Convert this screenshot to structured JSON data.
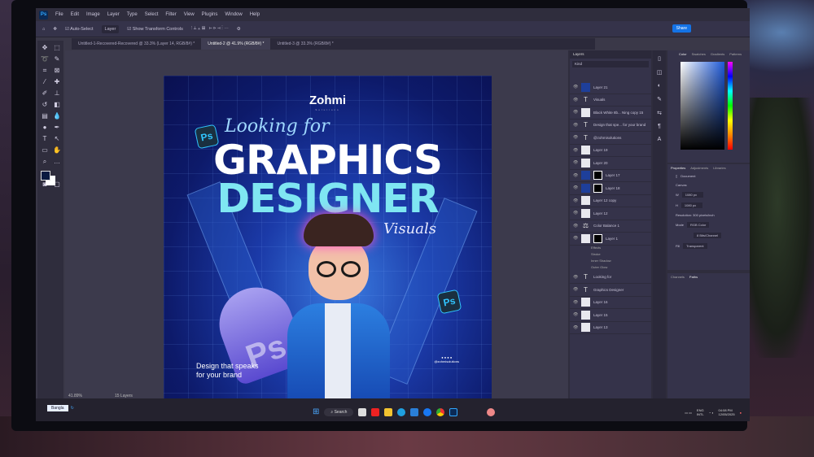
{
  "app": {
    "logo": "Ps",
    "menu": [
      "File",
      "Edit",
      "Image",
      "Layer",
      "Type",
      "Select",
      "Filter",
      "View",
      "Plugins",
      "Window",
      "Help"
    ]
  },
  "options": {
    "auto_select": "Auto-Select",
    "layer_select": "Layer",
    "transform": "Show Transform Controls",
    "share": "Share"
  },
  "tabs": [
    {
      "label": "Untitled-1-Recovered-Recovered @ 33.3% (Layer 14, RGB/8#) *",
      "active": false
    },
    {
      "label": "Untitled-2 @ 41.9% (RGB/8#) *",
      "active": true
    },
    {
      "label": "Untitled-3 @ 33.3% (RGB/8#) *",
      "active": false
    }
  ],
  "poster": {
    "brand": "Zohmi",
    "brand_sub": "Solutions",
    "looking": "Looking for",
    "title1": "GRAPHICS",
    "title2": "DESIGNER",
    "script": "Visuals",
    "badge": "Ps",
    "cap_text": "Ps",
    "tagline1": "Design that speaks",
    "tagline2": "for your brand",
    "handle": "@zohmisolutions"
  },
  "layers": {
    "title": "Layers",
    "search": "Kind",
    "items": [
      {
        "name": "Layer 21",
        "type": "img"
      },
      {
        "name": "Visuals",
        "type": "text"
      },
      {
        "name": "Black White 8b... Ning copy 15",
        "type": "plain"
      },
      {
        "name": "Design that spe... for your brand",
        "type": "text"
      },
      {
        "name": "@zohmisolutions",
        "type": "text"
      },
      {
        "name": "Layer 19",
        "type": "plain"
      },
      {
        "name": "Layer 20",
        "type": "plain"
      },
      {
        "name": "Layer 17",
        "type": "img",
        "mask": true
      },
      {
        "name": "Layer 18",
        "type": "img",
        "mask": true
      },
      {
        "name": "Layer 12 copy",
        "type": "plain"
      },
      {
        "name": "Layer 12",
        "type": "plain"
      },
      {
        "name": "Color Balance 1",
        "type": "adj"
      },
      {
        "name": "Layer 1",
        "type": "plain",
        "mask": true
      }
    ],
    "effects": [
      "Effects",
      "Stroke",
      "Inner Shadow",
      "Outer Glow"
    ],
    "items2": [
      {
        "name": "Looking for",
        "type": "text"
      },
      {
        "name": "Graphics Designer",
        "type": "text"
      },
      {
        "name": "Layer 16",
        "type": "plain"
      },
      {
        "name": "Layer 15",
        "type": "plain"
      },
      {
        "name": "Layer 13",
        "type": "plain"
      }
    ]
  },
  "color": {
    "tabs": [
      "Color",
      "Swatches",
      "Gradients",
      "Patterns"
    ],
    "foreground": "#0a1a40",
    "background": "#ffffff"
  },
  "properties": {
    "tabs": [
      "Properties",
      "Adjustments",
      "Libraries"
    ],
    "doc": "Document",
    "section": "Canvas",
    "w": "1080 px",
    "h": "1080 px",
    "resolution": "Resolution: 300 pixels/inch",
    "mode_label": "Mode",
    "mode": "RGB Color",
    "depth": "8 Bits/Channel",
    "fill_label": "Fill",
    "fill": "Transparent"
  },
  "bottom_panel": {
    "tabs": [
      "Channels",
      "Paths"
    ]
  },
  "status": {
    "zoom": "41.89%",
    "layers": "15 Layers"
  },
  "taskbar": {
    "lang": "Bangla",
    "search": "Search",
    "lang_code1": "ENG",
    "lang_code2": "INTL",
    "time": "04:08 PM",
    "date": "12/05/2025"
  }
}
